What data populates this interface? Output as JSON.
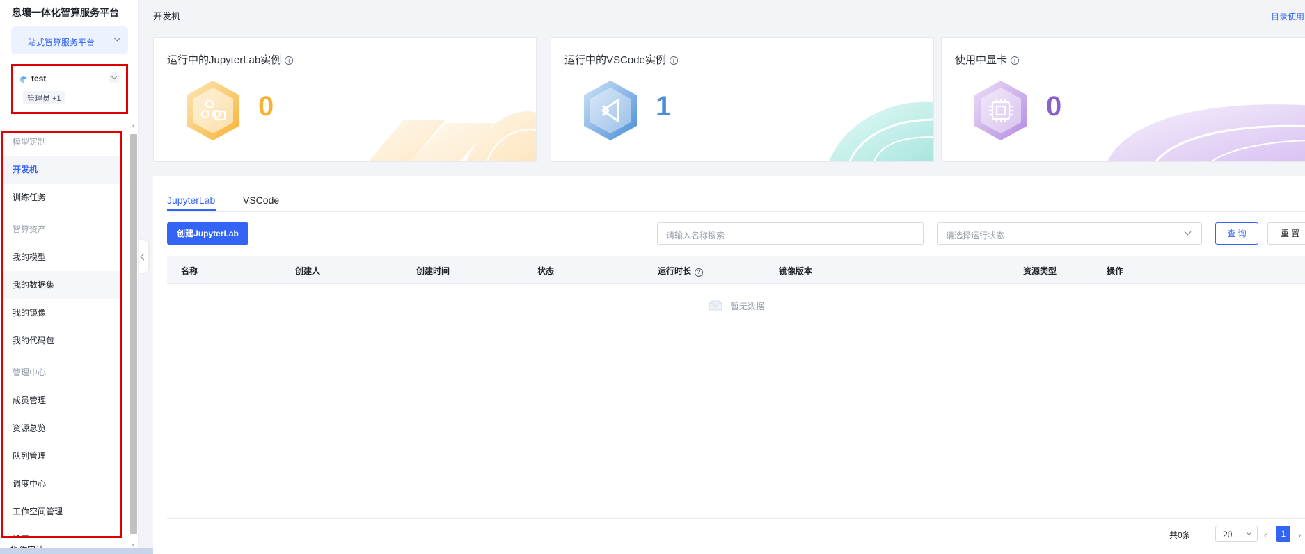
{
  "sidebar": {
    "brand": "息壤一体化智算服务平台",
    "platform_select": "一站式智算服务平台",
    "workspace": {
      "name": "test",
      "role": "管理员",
      "role_extra": "+1"
    },
    "sections": [
      {
        "title": "模型定制",
        "items": [
          "开发机",
          "训练任务"
        ]
      },
      {
        "title": "智算资产",
        "items": [
          "我的模型",
          "我的数据集",
          "我的镜像",
          "我的代码包"
        ]
      },
      {
        "title": "管理中心",
        "items": [
          "成员管理",
          "资源总览",
          "队列管理",
          "调度中心",
          "工作空间管理",
          "设置"
        ]
      }
    ],
    "active_item": "开发机",
    "footer_text": "操作审计"
  },
  "header": {
    "page_title": "开发机",
    "dir_link": "目录使用"
  },
  "stats": [
    {
      "title": "运行中的JupyterLab实例",
      "value": "0",
      "icon": "jupyter-hex-icon",
      "color": "#f7b234"
    },
    {
      "title": "运行中的VSCode实例",
      "value": "1",
      "icon": "vscode-hex-icon",
      "color": "#4a8cd6"
    },
    {
      "title": "使用中显卡",
      "value": "0",
      "icon": "gpu-chip-hex-icon",
      "color": "#8a63c9"
    }
  ],
  "panel": {
    "tabs": [
      "JupyterLab",
      "VSCode"
    ],
    "active_tab": "JupyterLab",
    "create_button": "创建JupyterLab",
    "search_placeholder": "请输入名称搜索",
    "status_placeholder": "请选择运行状态",
    "query_button": "查 询",
    "reset_button": "重 置",
    "columns": [
      "名称",
      "创建人",
      "创建时间",
      "状态",
      "运行时长",
      "镜像版本",
      "资源类型",
      "操作"
    ],
    "empty_text": "暂无数据",
    "pagination": {
      "total": "共0条",
      "page_size": "20",
      "current_page": "1"
    }
  },
  "colors": {
    "accent": "#3264f5",
    "highlight_border": "#e00000"
  }
}
